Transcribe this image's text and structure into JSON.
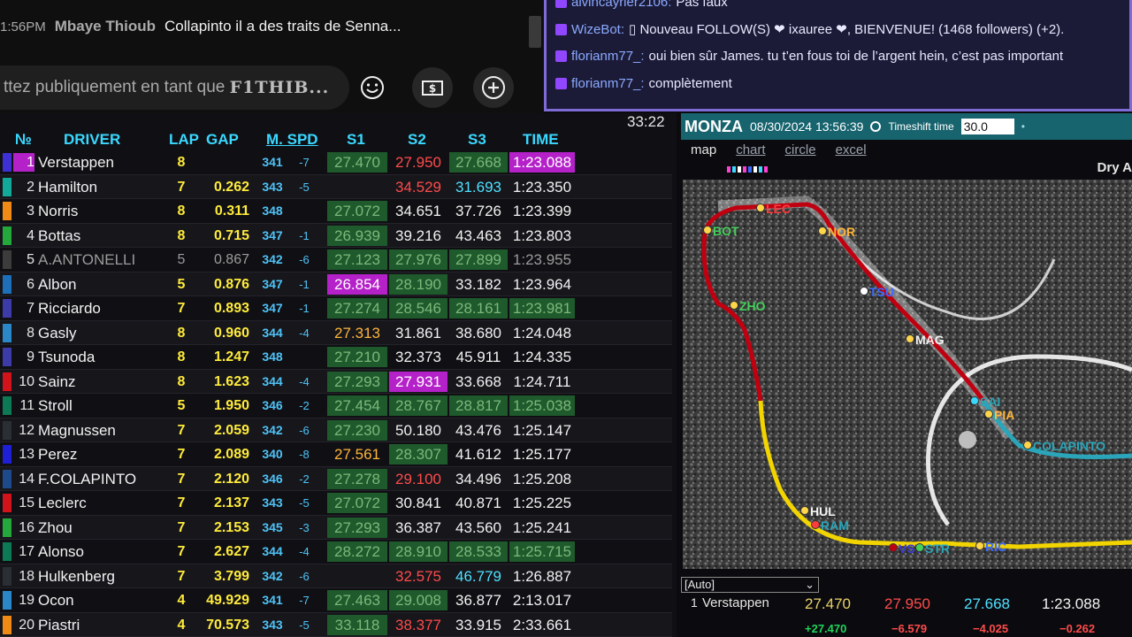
{
  "youtube": {
    "message": {
      "time": "1:56PM",
      "author": "Mbaye Thioub",
      "text": "Collapinto il a des traits de Senna..."
    },
    "input_placeholder": "ttez publiquement en tant que",
    "input_user": "F1THIB...",
    "buttons": {
      "emoji": "emoji-icon",
      "superchat": "dollar-icon",
      "add": "plus-icon"
    }
  },
  "twitch": {
    "messages": [
      {
        "user": "alvincayrier2106:",
        "text": "Pas faux"
      },
      {
        "user": "WizeBot:",
        "text": "▯ Nouveau FOLLOW(S) ❤ ixauree ❤, BIENVENUE! (1468 followers) (+2)."
      },
      {
        "user": "florianm77_:",
        "text": "oui bien sûr James. tu t’en fous toi de l’argent hein, c’est pas important"
      },
      {
        "user": "florianm77_:",
        "text": "complètement"
      }
    ]
  },
  "timing": {
    "clock": "33:22",
    "headers": {
      "pos": "№",
      "driver": "DRIVER",
      "lap": "LAP",
      "gap": "GAP",
      "speed": "M. SPD",
      "s1": "S1",
      "s2": "S2",
      "s3": "S3",
      "time": "TIME"
    },
    "rows": [
      {
        "pos": "1",
        "driver": "Verstappen",
        "lap": "8",
        "gap": "",
        "spd": "341",
        "spdd": "-7",
        "s1": "27.470",
        "s2": "27.950",
        "s3": "27.668",
        "time": "1:23.088",
        "team": "#3f30d6",
        "c1": "green",
        "c2": "red",
        "c3": "green",
        "ct": "purple",
        "pp": true
      },
      {
        "pos": "2",
        "driver": "Hamilton",
        "lap": "7",
        "gap": "0.262",
        "spd": "343",
        "spdd": "-5",
        "s1": "",
        "s2": "34.529",
        "s3": "31.693",
        "time": "1:23.350",
        "team": "#12a89a",
        "c1": "none",
        "c2": "red",
        "c3": "cyan",
        "ct": "white"
      },
      {
        "pos": "3",
        "driver": "Norris",
        "lap": "8",
        "gap": "0.311",
        "spd": "348",
        "spdd": "",
        "s1": "27.072",
        "s2": "34.651",
        "s3": "37.726",
        "time": "1:23.399",
        "team": "#ef8a17",
        "c1": "green",
        "c2": "white",
        "c3": "white",
        "ct": "white"
      },
      {
        "pos": "4",
        "driver": "Bottas",
        "lap": "8",
        "gap": "0.715",
        "spd": "347",
        "spdd": "-1",
        "s1": "26.939",
        "s2": "39.216",
        "s3": "43.463",
        "time": "1:23.803",
        "team": "#25a83b",
        "c1": "green",
        "c2": "white",
        "c3": "white",
        "ct": "white"
      },
      {
        "pos": "5",
        "driver": "A.ANTONELLI",
        "lap": "5",
        "gap": "0.867",
        "spd": "342",
        "spdd": "-6",
        "s1": "27.123",
        "s2": "27.976",
        "s3": "27.899",
        "time": "1:23.955",
        "team": "#3c3c3c",
        "c1": "green",
        "c2": "green",
        "c3": "green",
        "ct": "gray",
        "out": true
      },
      {
        "pos": "6",
        "driver": "Albon",
        "lap": "5",
        "gap": "0.876",
        "spd": "347",
        "spdd": "-1",
        "s1": "26.854",
        "s2": "28.190",
        "s3": "33.182",
        "time": "1:23.964",
        "team": "#1d6fb8",
        "c1": "purple",
        "c2": "green",
        "c3": "white",
        "ct": "white"
      },
      {
        "pos": "7",
        "driver": "Ricciardo",
        "lap": "7",
        "gap": "0.893",
        "spd": "347",
        "spdd": "-1",
        "s1": "27.274",
        "s2": "28.546",
        "s3": "28.161",
        "time": "1:23.981",
        "team": "#3d3ba8",
        "c1": "green",
        "c2": "green",
        "c3": "green",
        "ct": "green"
      },
      {
        "pos": "8",
        "driver": "Gasly",
        "lap": "8",
        "gap": "0.960",
        "spd": "344",
        "spdd": "-4",
        "s1": "27.313",
        "s2": "31.861",
        "s3": "38.680",
        "time": "1:24.048",
        "team": "#2b87c8",
        "c1": "orange",
        "c2": "white",
        "c3": "white",
        "ct": "white"
      },
      {
        "pos": "9",
        "driver": "Tsunoda",
        "lap": "8",
        "gap": "1.247",
        "spd": "348",
        "spdd": "",
        "s1": "27.210",
        "s2": "32.373",
        "s3": "45.911",
        "time": "1:24.335",
        "team": "#3d3ba8",
        "c1": "green",
        "c2": "white",
        "c3": "white",
        "ct": "white"
      },
      {
        "pos": "10",
        "driver": "Sainz",
        "lap": "8",
        "gap": "1.623",
        "spd": "344",
        "spdd": "-4",
        "s1": "27.293",
        "s2": "27.931",
        "s3": "33.668",
        "time": "1:24.711",
        "team": "#d1141b",
        "c1": "green",
        "c2": "purple",
        "c3": "white",
        "ct": "white"
      },
      {
        "pos": "11",
        "driver": "Stroll",
        "lap": "5",
        "gap": "1.950",
        "spd": "346",
        "spdd": "-2",
        "s1": "27.454",
        "s2": "28.767",
        "s3": "28.817",
        "time": "1:25.038",
        "team": "#0e7a55",
        "c1": "green",
        "c2": "green",
        "c3": "green",
        "ct": "green"
      },
      {
        "pos": "12",
        "driver": "Magnussen",
        "lap": "7",
        "gap": "2.059",
        "spd": "342",
        "spdd": "-6",
        "s1": "27.230",
        "s2": "50.180",
        "s3": "43.476",
        "time": "1:25.147",
        "team": "#2a2f35",
        "c1": "green",
        "c2": "white",
        "c3": "white",
        "ct": "white"
      },
      {
        "pos": "13",
        "driver": "Perez",
        "lap": "7",
        "gap": "2.089",
        "spd": "340",
        "spdd": "-8",
        "s1": "27.561",
        "s2": "28.307",
        "s3": "41.612",
        "time": "1:25.177",
        "team": "#1f1fd6",
        "c1": "orange",
        "c2": "green",
        "c3": "white",
        "ct": "white"
      },
      {
        "pos": "14",
        "driver": "F.COLAPINTO",
        "lap": "7",
        "gap": "2.120",
        "spd": "346",
        "spdd": "-2",
        "s1": "27.278",
        "s2": "29.100",
        "s3": "34.496",
        "time": "1:25.208",
        "team": "#1e4a8a",
        "c1": "green",
        "c2": "red",
        "c3": "white",
        "ct": "white"
      },
      {
        "pos": "15",
        "driver": "Leclerc",
        "lap": "7",
        "gap": "2.137",
        "spd": "343",
        "spdd": "-5",
        "s1": "27.072",
        "s2": "30.841",
        "s3": "40.871",
        "time": "1:25.225",
        "team": "#d1141b",
        "c1": "green",
        "c2": "white",
        "c3": "white",
        "ct": "white"
      },
      {
        "pos": "16",
        "driver": "Zhou",
        "lap": "7",
        "gap": "2.153",
        "spd": "345",
        "spdd": "-3",
        "s1": "27.293",
        "s2": "36.387",
        "s3": "43.560",
        "time": "1:25.241",
        "team": "#25a83b",
        "c1": "green",
        "c2": "white",
        "c3": "white",
        "ct": "white"
      },
      {
        "pos": "17",
        "driver": "Alonso",
        "lap": "7",
        "gap": "2.627",
        "spd": "344",
        "spdd": "-4",
        "s1": "28.272",
        "s2": "28.910",
        "s3": "28.533",
        "time": "1:25.715",
        "team": "#0e7a55",
        "c1": "green",
        "c2": "green",
        "c3": "green",
        "ct": "green"
      },
      {
        "pos": "18",
        "driver": "Hulkenberg",
        "lap": "7",
        "gap": "3.799",
        "spd": "342",
        "spdd": "-6",
        "s1": "",
        "s2": "32.575",
        "s3": "46.779",
        "time": "1:26.887",
        "team": "#2a2f35",
        "c1": "none",
        "c2": "red",
        "c3": "cyan",
        "ct": "white"
      },
      {
        "pos": "19",
        "driver": "Ocon",
        "lap": "4",
        "gap": "49.929",
        "spd": "341",
        "spdd": "-7",
        "s1": "27.463",
        "s2": "29.008",
        "s3": "36.877",
        "time": "2:13.017",
        "team": "#2b87c8",
        "c1": "green",
        "c2": "green",
        "c3": "white",
        "ct": "white"
      },
      {
        "pos": "20",
        "driver": "Piastri",
        "lap": "4",
        "gap": "70.573",
        "spd": "343",
        "spdd": "-5",
        "s1": "33.118",
        "s2": "38.377",
        "s3": "33.915",
        "time": "2:33.661",
        "team": "#ef8a17",
        "c1": "green",
        "c2": "red",
        "c3": "white",
        "ct": "white"
      }
    ]
  },
  "map_panel": {
    "track": "MONZA",
    "datetime": "08/30/2024 13:56:39",
    "timeshift_label": "Timeshift time",
    "timeshift_value": "30.0",
    "dot": "•",
    "tabs": [
      "map",
      "chart",
      "circle",
      "excel"
    ],
    "active_tab": "map",
    "weather": "Dry A",
    "driver_tags": [
      "BOT",
      "LEC",
      "NOR",
      "ZHO",
      "TSU",
      "MAG",
      "SAI",
      "PIA",
      "COLAPINTO",
      "HUL",
      "RAM",
      "VST",
      "STR",
      "RIC"
    ],
    "select_value": "[Auto]",
    "selected_driver": {
      "pos": "1",
      "name": "Verstappen",
      "s1": "27.470",
      "s2": "27.950",
      "s3": "27.668",
      "time": "1:23.088"
    },
    "deltas": {
      "s1": "+27.470",
      "s2": "−6.579",
      "s3": "−4.025",
      "time": "−0.262"
    }
  }
}
